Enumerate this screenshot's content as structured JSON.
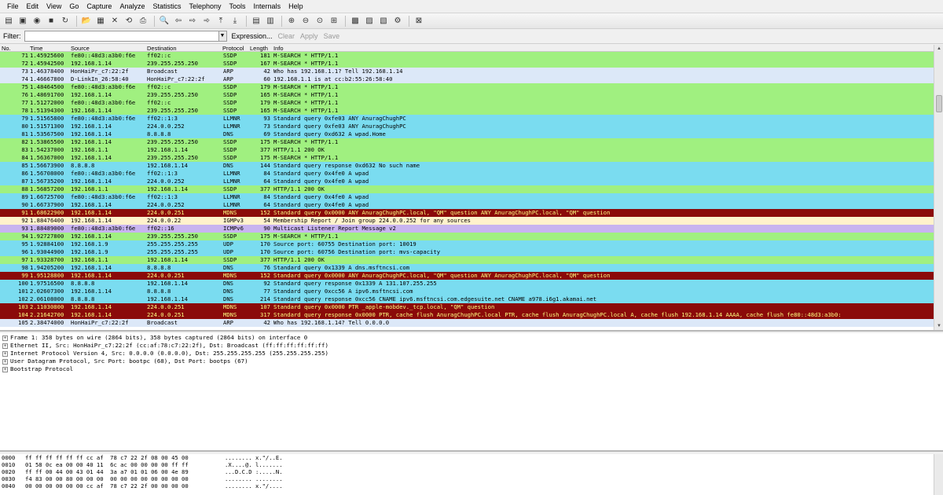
{
  "menu": [
    "File",
    "Edit",
    "View",
    "Go",
    "Capture",
    "Analyze",
    "Statistics",
    "Telephony",
    "Tools",
    "Internals",
    "Help"
  ],
  "toolbar": {
    "buttons": [
      {
        "name": "interfaces-icon",
        "glyph": "▤"
      },
      {
        "name": "capture-options-icon",
        "glyph": "▣"
      },
      {
        "name": "start-capture-icon",
        "glyph": "◉"
      },
      {
        "name": "stop-capture-icon",
        "glyph": "■"
      },
      {
        "name": "restart-capture-icon",
        "glyph": "↻"
      },
      {
        "sep": true
      },
      {
        "name": "open-icon",
        "glyph": "📂"
      },
      {
        "name": "save-icon",
        "glyph": "▦"
      },
      {
        "name": "close-file-icon",
        "glyph": "✕"
      },
      {
        "name": "reload-icon",
        "glyph": "⟲"
      },
      {
        "name": "print-icon",
        "glyph": "⎙"
      },
      {
        "sep": true
      },
      {
        "name": "find-icon",
        "glyph": "🔍"
      },
      {
        "name": "back-icon",
        "glyph": "⇦"
      },
      {
        "name": "forward-icon",
        "glyph": "⇨"
      },
      {
        "name": "goto-icon",
        "glyph": "➾"
      },
      {
        "name": "first-packet-icon",
        "glyph": "⤒"
      },
      {
        "name": "last-packet-icon",
        "glyph": "⤓"
      },
      {
        "sep": true
      },
      {
        "name": "colorize-icon",
        "glyph": "▤"
      },
      {
        "name": "autoscroll-icon",
        "glyph": "▥"
      },
      {
        "sep": true
      },
      {
        "name": "zoom-in-icon",
        "glyph": "⊕"
      },
      {
        "name": "zoom-out-icon",
        "glyph": "⊖"
      },
      {
        "name": "zoom-normal-icon",
        "glyph": "⊙"
      },
      {
        "name": "resize-columns-icon",
        "glyph": "⊞"
      },
      {
        "sep": true
      },
      {
        "name": "capture-filters-icon",
        "glyph": "▩"
      },
      {
        "name": "display-filters-icon",
        "glyph": "▨"
      },
      {
        "name": "coloring-rules-icon",
        "glyph": "▧"
      },
      {
        "name": "preferences-icon",
        "glyph": "⚙"
      },
      {
        "sep": true
      },
      {
        "name": "help-icon",
        "glyph": "⊠"
      }
    ]
  },
  "filter": {
    "label": "Filter:",
    "value": "",
    "expression": "Expression...",
    "clear": "Clear",
    "apply": "Apply",
    "save": "Save"
  },
  "columns": {
    "no": "No.",
    "time": "Time",
    "source": "Source",
    "destination": "Destination",
    "protocol": "Protocol",
    "length": "Length",
    "info": "Info"
  },
  "colors": {
    "ssdp": "#a0f080",
    "arp": "#dce8f8",
    "llmnr": "#7adcf0",
    "dns": "#7adcf0",
    "udp": "#7adcf0",
    "mdns_bad": "#8b0a0a",
    "igmp": "#fff2cc",
    "icmpv6": "#c8b4f0"
  },
  "packets": [
    {
      "no": "71",
      "time": "1.45925600",
      "src": "fe80::48d3:a3b0:f6e",
      "dst": "ff02::c",
      "proto": "SSDP",
      "len": "181",
      "info": "M-SEARCH * HTTP/1.1",
      "color": "ssdp"
    },
    {
      "no": "72",
      "time": "1.45942500",
      "src": "192.168.1.14",
      "dst": "239.255.255.250",
      "proto": "SSDP",
      "len": "167",
      "info": "M-SEARCH * HTTP/1.1",
      "color": "ssdp"
    },
    {
      "no": "73",
      "time": "1.46378400",
      "src": "HonHaiPr_c7:22:2f",
      "dst": "Broadcast",
      "proto": "ARP",
      "len": "42",
      "info": "Who has 192.168.1.1?  Tell 192.168.1.14",
      "color": "arp"
    },
    {
      "no": "74",
      "time": "1.46667800",
      "src": "D-LinkIn_26:58:40",
      "dst": "HonHaiPr_c7:22:2f",
      "proto": "ARP",
      "len": "60",
      "info": "192.168.1.1 is at cc:b2:55:26:58:40",
      "color": "arp"
    },
    {
      "no": "75",
      "time": "1.48464500",
      "src": "fe80::48d3:a3b0:f6e",
      "dst": "ff02::c",
      "proto": "SSDP",
      "len": "179",
      "info": "M-SEARCH * HTTP/1.1",
      "color": "ssdp"
    },
    {
      "no": "76",
      "time": "1.48691700",
      "src": "192.168.1.14",
      "dst": "239.255.255.250",
      "proto": "SSDP",
      "len": "165",
      "info": "M-SEARCH * HTTP/1.1",
      "color": "ssdp"
    },
    {
      "no": "77",
      "time": "1.51272000",
      "src": "fe80::48d3:a3b0:f6e",
      "dst": "ff02::c",
      "proto": "SSDP",
      "len": "179",
      "info": "M-SEARCH * HTTP/1.1",
      "color": "ssdp"
    },
    {
      "no": "78",
      "time": "1.51394300",
      "src": "192.168.1.14",
      "dst": "239.255.255.250",
      "proto": "SSDP",
      "len": "165",
      "info": "M-SEARCH * HTTP/1.1",
      "color": "ssdp"
    },
    {
      "no": "79",
      "time": "1.51565800",
      "src": "fe80::48d3:a3b0:f6e",
      "dst": "ff02::1:3",
      "proto": "LLMNR",
      "len": "93",
      "info": "Standard query 0xfe03  ANY AnuragChughPC",
      "color": "llmnr"
    },
    {
      "no": "80",
      "time": "1.51571300",
      "src": "192.168.1.14",
      "dst": "224.0.0.252",
      "proto": "LLMNR",
      "len": "73",
      "info": "Standard query 0xfe03  ANY AnuragChughPC",
      "color": "llmnr"
    },
    {
      "no": "81",
      "time": "1.53567500",
      "src": "192.168.1.14",
      "dst": "8.8.8.8",
      "proto": "DNS",
      "len": "69",
      "info": "Standard query 0xd632  A wpad.Home",
      "color": "dns"
    },
    {
      "no": "82",
      "time": "1.53865500",
      "src": "192.168.1.14",
      "dst": "239.255.255.250",
      "proto": "SSDP",
      "len": "175",
      "info": "M-SEARCH * HTTP/1.1",
      "color": "ssdp"
    },
    {
      "no": "83",
      "time": "1.54237000",
      "src": "192.168.1.1",
      "dst": "192.168.1.14",
      "proto": "SSDP",
      "len": "377",
      "info": "HTTP/1.1 200 OK",
      "color": "ssdp"
    },
    {
      "no": "84",
      "time": "1.56367000",
      "src": "192.168.1.14",
      "dst": "239.255.255.250",
      "proto": "SSDP",
      "len": "175",
      "info": "M-SEARCH * HTTP/1.1",
      "color": "ssdp"
    },
    {
      "no": "85",
      "time": "1.56673900",
      "src": "8.8.8.8",
      "dst": "192.168.1.14",
      "proto": "DNS",
      "len": "144",
      "info": "Standard query response 0xd632 No such name",
      "color": "dns"
    },
    {
      "no": "86",
      "time": "1.56708000",
      "src": "fe80::48d3:a3b0:f6e",
      "dst": "ff02::1:3",
      "proto": "LLMNR",
      "len": "84",
      "info": "Standard query 0x4fe0  A wpad",
      "color": "llmnr"
    },
    {
      "no": "87",
      "time": "1.56735200",
      "src": "192.168.1.14",
      "dst": "224.0.0.252",
      "proto": "LLMNR",
      "len": "64",
      "info": "Standard query 0x4fe0  A wpad",
      "color": "llmnr"
    },
    {
      "no": "88",
      "time": "1.56857200",
      "src": "192.168.1.1",
      "dst": "192.168.1.14",
      "proto": "SSDP",
      "len": "377",
      "info": "HTTP/1.1 200 OK",
      "color": "ssdp"
    },
    {
      "no": "89",
      "time": "1.66725700",
      "src": "fe80::48d3:a3b0:f6e",
      "dst": "ff02::1:3",
      "proto": "LLMNR",
      "len": "84",
      "info": "Standard query 0x4fe0  A wpad",
      "color": "llmnr"
    },
    {
      "no": "90",
      "time": "1.66737900",
      "src": "192.168.1.14",
      "dst": "224.0.0.252",
      "proto": "LLMNR",
      "len": "64",
      "info": "Standard query 0x4fe0  A wpad",
      "color": "llmnr"
    },
    {
      "no": "91",
      "time": "1.68622900",
      "src": "192.168.1.14",
      "dst": "224.0.0.251",
      "proto": "MDNS",
      "len": "152",
      "info": "Standard query 0x0000  ANY AnuragChughPC.local, \"QM\" question ANY AnuragChughPC.local, \"QM\" question",
      "color": "mdns_bad"
    },
    {
      "no": "92",
      "time": "1.88476400",
      "src": "192.168.1.14",
      "dst": "224.0.0.22",
      "proto": "IGMPv3",
      "len": "54",
      "info": "Membership Report / Join group 224.0.0.252 for any sources",
      "color": "igmp"
    },
    {
      "no": "93",
      "time": "1.88489000",
      "src": "fe80::48d3:a3b0:f6e",
      "dst": "ff02::16",
      "proto": "ICMPv6",
      "len": "90",
      "info": "Multicast Listener Report Message v2",
      "color": "icmpv6"
    },
    {
      "no": "94",
      "time": "1.92727800",
      "src": "192.168.1.14",
      "dst": "239.255.255.250",
      "proto": "SSDP",
      "len": "175",
      "info": "M-SEARCH * HTTP/1.1",
      "color": "ssdp"
    },
    {
      "no": "95",
      "time": "1.92884100",
      "src": "192.168.1.9",
      "dst": "255.255.255.255",
      "proto": "UDP",
      "len": "170",
      "info": "Source port: 60755  Destination port: 10019",
      "color": "udp"
    },
    {
      "no": "96",
      "time": "1.93044900",
      "src": "192.168.1.9",
      "dst": "255.255.255.255",
      "proto": "UDP",
      "len": "170",
      "info": "Source port: 60756  Destination port: mvs-capacity",
      "color": "udp"
    },
    {
      "no": "97",
      "time": "1.93328700",
      "src": "192.168.1.1",
      "dst": "192.168.1.14",
      "proto": "SSDP",
      "len": "377",
      "info": "HTTP/1.1 200 OK",
      "color": "ssdp"
    },
    {
      "no": "98",
      "time": "1.94205200",
      "src": "192.168.1.14",
      "dst": "8.8.8.8",
      "proto": "DNS",
      "len": "76",
      "info": "Standard query 0x1339  A dns.msftncsi.com",
      "color": "dns"
    },
    {
      "no": "99",
      "time": "1.95128800",
      "src": "192.168.1.14",
      "dst": "224.0.0.251",
      "proto": "MDNS",
      "len": "152",
      "info": "Standard query 0x0000  ANY AnuragChughPC.local, \"QM\" question ANY AnuragChughPC.local, \"QM\" question",
      "color": "mdns_bad"
    },
    {
      "no": "100",
      "time": "1.97516500",
      "src": "8.8.8.8",
      "dst": "192.168.1.14",
      "proto": "DNS",
      "len": "92",
      "info": "Standard query response 0x1339  A 131.107.255.255",
      "color": "dns"
    },
    {
      "no": "101",
      "time": "2.02607300",
      "src": "192.168.1.14",
      "dst": "8.8.8.8",
      "proto": "DNS",
      "len": "77",
      "info": "Standard query 0xcc56  A ipv6.msftncsi.com",
      "color": "dns"
    },
    {
      "no": "102",
      "time": "2.06108000",
      "src": "8.8.8.8",
      "dst": "192.168.1.14",
      "proto": "DNS",
      "len": "214",
      "info": "Standard query response 0xcc56  CNAME ipv6.msftncsi.com.edgesuite.net CNAME a978.i6g1.akamai.net",
      "color": "dns"
    },
    {
      "no": "103",
      "time": "2.11030800",
      "src": "192.168.1.14",
      "dst": "224.0.0.251",
      "proto": "MDNS",
      "len": "107",
      "info": "Standard query 0x0000  PTR _apple-mobdev._tcp.local, \"QM\" question",
      "color": "mdns_bad"
    },
    {
      "no": "104",
      "time": "2.21642700",
      "src": "192.168.1.14",
      "dst": "224.0.0.251",
      "proto": "MDNS",
      "len": "317",
      "info": "Standard query response 0x0000  PTR, cache flush AnuragChughPC.local PTR, cache flush AnuragChughPC.local A, cache flush 192.168.1.14 AAAA, cache flush fe80::48d3:a3b0:",
      "color": "mdns_bad"
    },
    {
      "no": "105",
      "time": "2.38474000",
      "src": "HonHaiPr_c7:22:2f",
      "dst": "Broadcast",
      "proto": "ARP",
      "len": "42",
      "info": "Who has 192.168.1.14?  Tell 0.0.0.0",
      "color": "arp"
    }
  ],
  "details": [
    "Frame 1: 358 bytes on wire (2864 bits), 358 bytes captured (2864 bits) on interface 0",
    "Ethernet II, Src: HonHaiPr_c7:22:2f (cc:af:78:c7:22:2f), Dst: Broadcast (ff:ff:ff:ff:ff:ff)",
    "Internet Protocol Version 4, Src: 0.0.0.0 (0.0.0.0), Dst: 255.255.255.255 (255.255.255.255)",
    "User Datagram Protocol, Src Port: bootpc (68), Dst Port: bootps (67)",
    "Bootstrap Protocol"
  ],
  "bytes": [
    {
      "offset": "0000",
      "hex": "ff ff ff ff ff ff cc af  78 c7 22 2f 08 00 45 00",
      "ascii": "........ x.\"/..E."
    },
    {
      "offset": "0010",
      "hex": "01 58 0c ea 00 00 40 11  6c ac 00 00 00 00 ff ff",
      "ascii": ".X....@. l......."
    },
    {
      "offset": "0020",
      "hex": "ff ff 00 44 00 43 01 44  3a a7 01 01 06 00 4e 89",
      "ascii": "...D.C.D :.....N."
    },
    {
      "offset": "0030",
      "hex": "f4 83 00 00 80 00 00 00  00 00 00 00 00 00 00 00",
      "ascii": "........ ........"
    },
    {
      "offset": "0040",
      "hex": "00 00 00 00 00 00 cc af  78 c7 22 2f 00 00 00 00",
      "ascii": "........ x.\"/...."
    }
  ]
}
